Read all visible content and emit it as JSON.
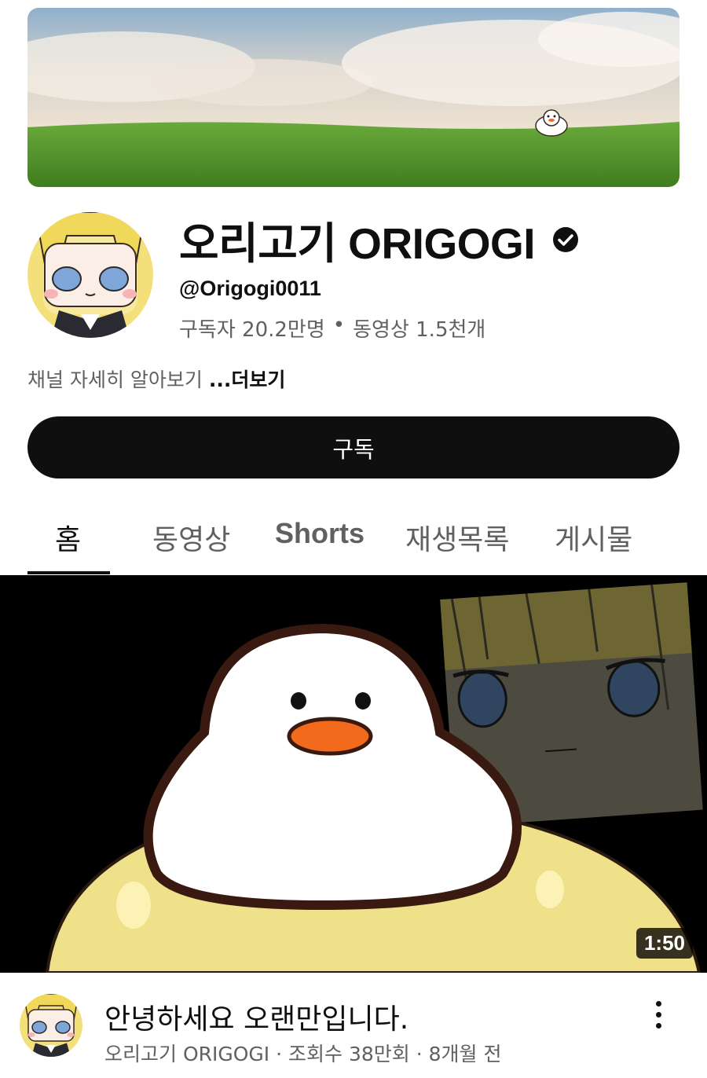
{
  "channel": {
    "name": "오리고기 ORIGOGI",
    "handle": "@Origogi0011",
    "subscribers": "구독자 20.2만명",
    "separator": "•",
    "videos": "동영상 1.5천개",
    "description": "채널 자세히 알아보기",
    "more": "...더보기",
    "verified_icon": "verified-check-icon"
  },
  "subscribe_button": {
    "label": "구독"
  },
  "tabs": [
    {
      "label": "홈",
      "active": true
    },
    {
      "label": "동영상",
      "active": false
    },
    {
      "label": "Shorts",
      "active": false
    },
    {
      "label": "재생목록",
      "active": false
    },
    {
      "label": "게시물",
      "active": false
    }
  ],
  "featured_video": {
    "duration": "1:50",
    "title": "안녕하세요 오랜만입니다.",
    "meta": "오리고기 ORIGOGI · 조회수 38만회 · 8개월 전",
    "menu_icon": "more-vert-icon"
  },
  "colors": {
    "text_primary": "#0f0f0f",
    "text_secondary": "#606060",
    "button_bg": "#0f0f0f",
    "button_text": "#ffffff"
  }
}
